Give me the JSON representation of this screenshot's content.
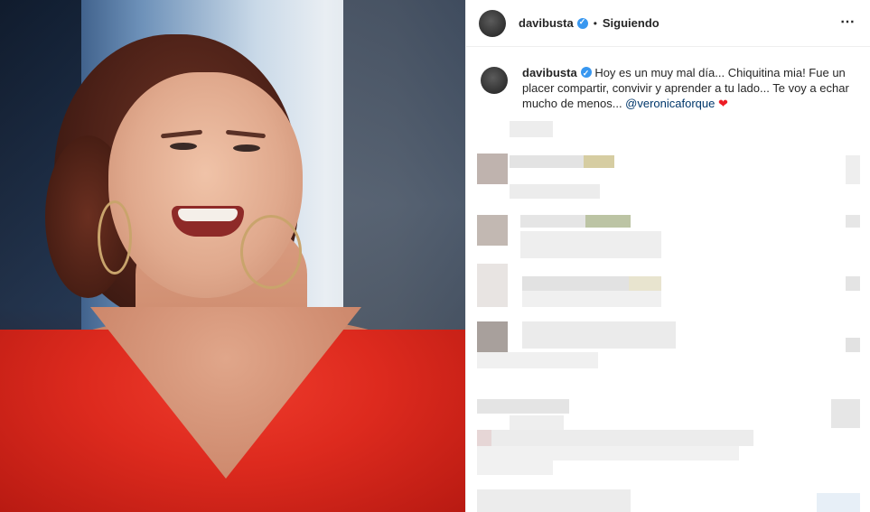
{
  "post": {
    "username": "davibusta",
    "follow_status": "Siguiendo",
    "separator": "•",
    "more_icon": "⋯",
    "caption": {
      "username": "davibusta",
      "text": "Hoy es un muy mal día... Chiquitina mia! Fue un placer compartir, convivir y aprender a tu lado... Te voy a echar mucho de menos... ",
      "mention": "@veronicaforque",
      "emoji": "❤"
    }
  },
  "colors": {
    "verified": "#3897f0",
    "mention": "#00376b",
    "heart": "#ed1c24",
    "dress": "#dd2a1e"
  }
}
